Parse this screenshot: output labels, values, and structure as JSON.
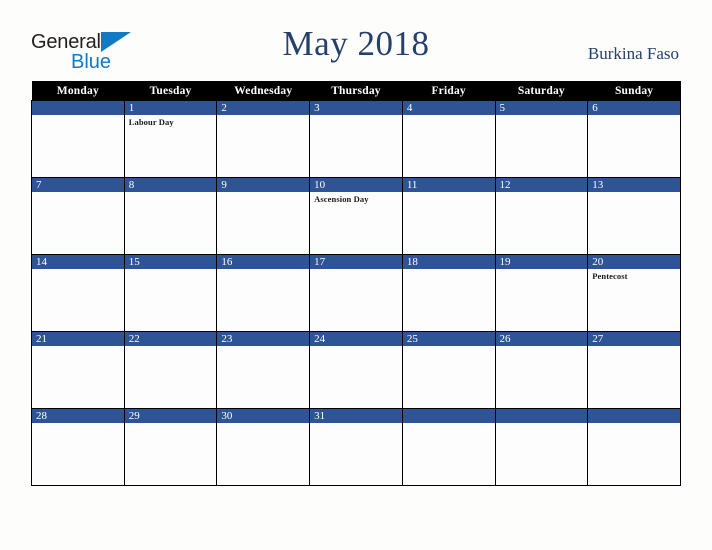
{
  "brand": {
    "line1": "General",
    "line2": "Blue",
    "triangle_icon": "triangle-icon",
    "color_dark": "#231f20",
    "color_blue": "#1279c5"
  },
  "header": {
    "title": "May 2018",
    "country": "Burkina Faso",
    "title_color": "#26406c"
  },
  "calendar": {
    "weekday_headers": [
      "Monday",
      "Tuesday",
      "Wednesday",
      "Thursday",
      "Friday",
      "Saturday",
      "Sunday"
    ],
    "header_bg": "#000000",
    "daynum_bg": "#2e5496",
    "cell_bg": "#fdfdfd",
    "weeks": [
      [
        {
          "day": "",
          "event": ""
        },
        {
          "day": "1",
          "event": "Labour Day"
        },
        {
          "day": "2",
          "event": ""
        },
        {
          "day": "3",
          "event": ""
        },
        {
          "day": "4",
          "event": ""
        },
        {
          "day": "5",
          "event": ""
        },
        {
          "day": "6",
          "event": ""
        }
      ],
      [
        {
          "day": "7",
          "event": ""
        },
        {
          "day": "8",
          "event": ""
        },
        {
          "day": "9",
          "event": ""
        },
        {
          "day": "10",
          "event": "Ascension Day"
        },
        {
          "day": "11",
          "event": ""
        },
        {
          "day": "12",
          "event": ""
        },
        {
          "day": "13",
          "event": ""
        }
      ],
      [
        {
          "day": "14",
          "event": ""
        },
        {
          "day": "15",
          "event": ""
        },
        {
          "day": "16",
          "event": ""
        },
        {
          "day": "17",
          "event": ""
        },
        {
          "day": "18",
          "event": ""
        },
        {
          "day": "19",
          "event": ""
        },
        {
          "day": "20",
          "event": "Pentecost"
        }
      ],
      [
        {
          "day": "21",
          "event": ""
        },
        {
          "day": "22",
          "event": ""
        },
        {
          "day": "23",
          "event": ""
        },
        {
          "day": "24",
          "event": ""
        },
        {
          "day": "25",
          "event": ""
        },
        {
          "day": "26",
          "event": ""
        },
        {
          "day": "27",
          "event": ""
        }
      ],
      [
        {
          "day": "28",
          "event": ""
        },
        {
          "day": "29",
          "event": ""
        },
        {
          "day": "30",
          "event": ""
        },
        {
          "day": "31",
          "event": ""
        },
        {
          "day": "",
          "event": ""
        },
        {
          "day": "",
          "event": ""
        },
        {
          "day": "",
          "event": ""
        }
      ]
    ]
  }
}
